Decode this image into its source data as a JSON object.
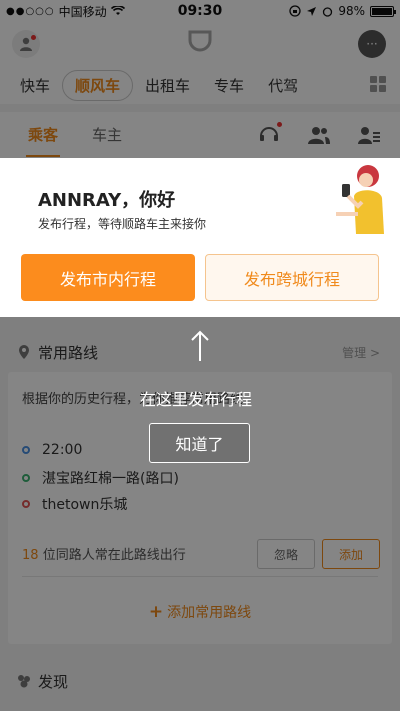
{
  "status_bar": {
    "signal": "●●○○○",
    "carrier": "中国移动",
    "wifi_icon": "wifi-icon",
    "time": "09:30",
    "battery_percent": "98%",
    "battery_level": 0.98
  },
  "header": {
    "avatar_icon": "user-avatar-icon",
    "logo_icon": "didi-logo-icon",
    "message_icon": "message-icon",
    "message_glyph": "···"
  },
  "services": [
    "快车",
    "顺风车",
    "出租车",
    "专车",
    "代驾"
  ],
  "active_service": "顺风车",
  "roles": {
    "passenger": "乘客",
    "driver": "车主"
  },
  "greeting": {
    "title": "ANNRAY，你好",
    "subtitle": "发布行程，等待顺路车主来接你",
    "city_button": "发布市内行程",
    "intercity_button": "发布跨城行程"
  },
  "frequent_routes": {
    "title": "常用路线",
    "manage": "管理 >",
    "hint": "根据你的历史行程，为你推荐常用路线",
    "time": "22:00",
    "from": "湛宝路红棉一路(路口)",
    "to": "thetown乐城",
    "count": "18",
    "count_text": "位同路人常在此路线出行",
    "ignore_button": "忽略",
    "add_button": "添加",
    "add_route": "添加常用路线"
  },
  "discover": {
    "title": "发现"
  },
  "coach_mark": {
    "text": "在这里发布行程",
    "ok_button": "知道了"
  },
  "colors": {
    "accent": "#fc8c1d",
    "accent_text": "#f08a1c"
  }
}
